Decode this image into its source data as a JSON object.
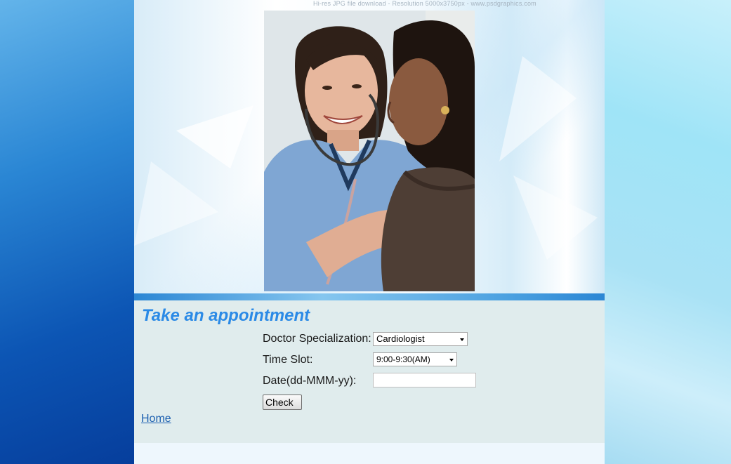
{
  "banner": {
    "watermark": "Hi-res JPG file download   -   Resolution 5000x3750px   -   www.psdgraphics.com"
  },
  "appointment": {
    "title": "Take an appointment",
    "specialization_label": "Doctor Specialization:",
    "specialization_value": "Cardiologist",
    "timeslot_label": "Time Slot:",
    "timeslot_value": "9:00-9:30(AM)",
    "date_label": "Date(dd-MMM-yy):",
    "date_value": "",
    "check_label": "Check"
  },
  "nav": {
    "home_label": "Home"
  }
}
